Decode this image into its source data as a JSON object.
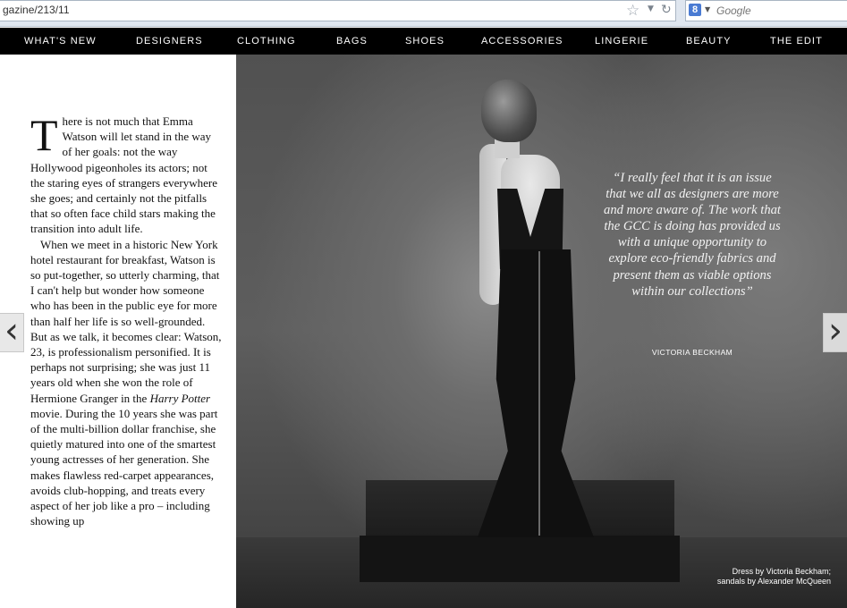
{
  "browser": {
    "url": "gazine/213/11",
    "search_placeholder": "Google",
    "google_badge": "8"
  },
  "nav": {
    "items": [
      "WHAT'S NEW",
      "DESIGNERS",
      "CLOTHING",
      "BAGS",
      "SHOES",
      "ACCESSORIES",
      "LINGERIE",
      "BEAUTY",
      "THE EDIT"
    ]
  },
  "article": {
    "dropcap": "T",
    "para1_rest": "here is not much that Emma Watson will let stand in the way of her goals: not the way Hollywood pigeonholes its actors; not the staring eyes of strangers everywhere she goes; and certainly not the pitfalls that so often face child stars making the transition into adult life.",
    "para2_before_italic": "When we meet in a historic New York hotel restaurant for breakfast, Watson is so put-together, so utterly charming, that I can't help but wonder how someone who has been in the public eye for more than half her life is so well-grounded. But as we talk, it becomes clear: Watson, 23, is professionalism personified. It is perhaps not surprising; she was just 11 years old when she won the role of Hermione Granger in the ",
    "para2_italic": "Harry Potter",
    "para2_after_italic": " movie. During the 10 years she was part of the multi-billion dollar franchise, she quietly matured into one of the smartest young actresses of her generation. She makes flawless red-carpet appearances, avoids club-hopping, and treats every aspect of her job like a pro – including showing up"
  },
  "feature": {
    "quote": "“I really feel that it is an issue that we all as designers are more and more aware of. The work that the GCC is doing has provided us with a unique opportunity to explore eco-friendly fabrics and present them as viable options within our collections”",
    "quote_author": "VICTORIA BECKHAM",
    "credit": "Dress by Victoria Beckham; sandals by Alexander McQueen"
  },
  "arrows": {
    "prev": "‹",
    "next": "›"
  }
}
